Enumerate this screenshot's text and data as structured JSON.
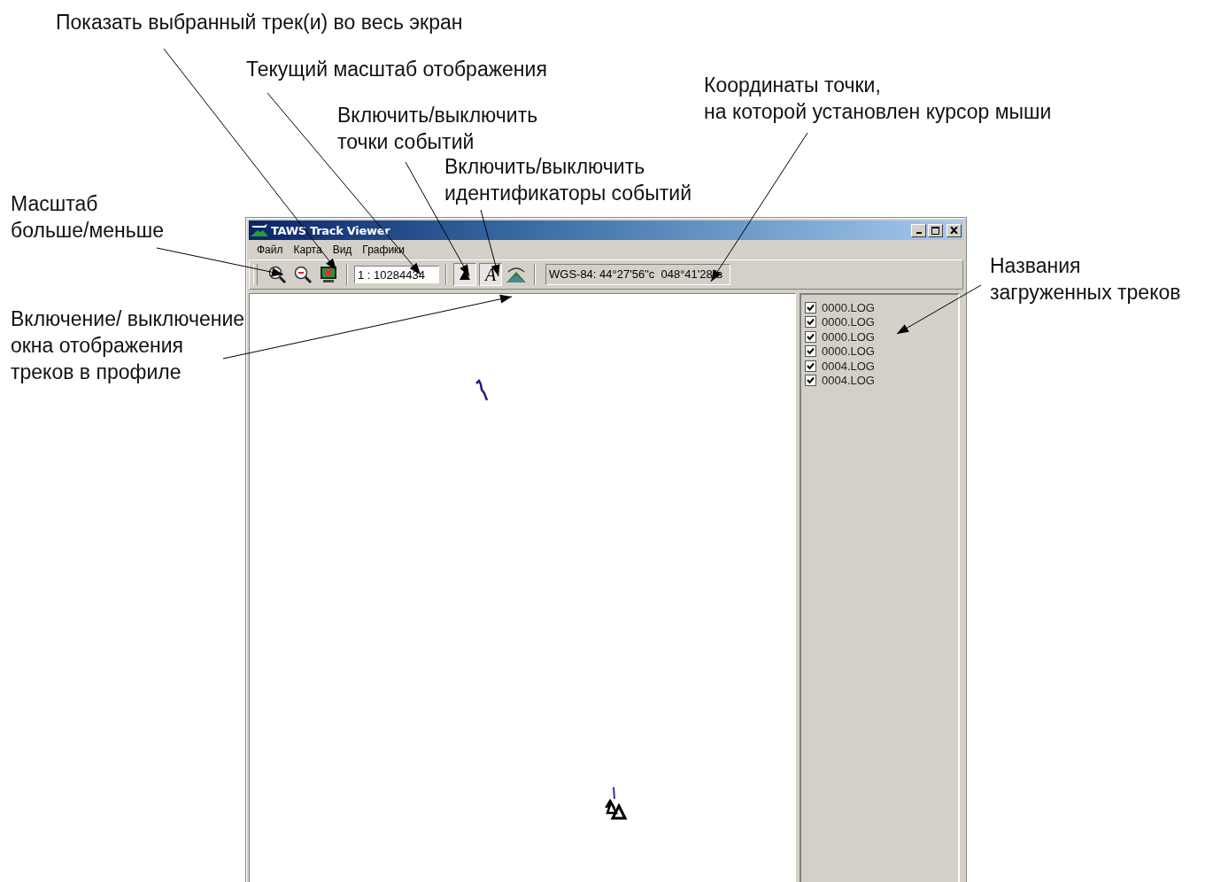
{
  "annotations": [
    {
      "text": "Показать выбранный трек(и) во весь экран"
    },
    {
      "text": "Текущий масштаб отображения"
    },
    {
      "text": "Включить/выключить\nточки событий"
    },
    {
      "text": "Включить/выключить\nидентификаторы событий"
    },
    {
      "text": "Координаты точки,\nна которой установлен курсор мыши"
    },
    {
      "text": "Масштаб\nбольше/меньше"
    },
    {
      "text": "Включение/ выключение\nокна отображения\nтреков в профиле"
    },
    {
      "text": "Названия\nзагруженных треков"
    }
  ],
  "window": {
    "title": "TAWS Track Viewer"
  },
  "menu": [
    "Файл",
    "Карта",
    "Вид",
    "Графики"
  ],
  "toolbar": {
    "scale": "1 : 10284434",
    "event_points": {
      "pressed": true
    },
    "event_ids": {
      "label": "A",
      "pressed": true
    },
    "profile": {
      "pressed": false
    },
    "coordinates": "WGS-84: 44°27'56\"с  048°41'28\"в"
  },
  "tracks": [
    {
      "name": "0000.LOG",
      "checked": true
    },
    {
      "name": "0000.LOG",
      "checked": true
    },
    {
      "name": "0000.LOG",
      "checked": true
    },
    {
      "name": "0000.LOG",
      "checked": true
    },
    {
      "name": "0004.LOG",
      "checked": true
    },
    {
      "name": "0004.LOG",
      "checked": true
    }
  ]
}
